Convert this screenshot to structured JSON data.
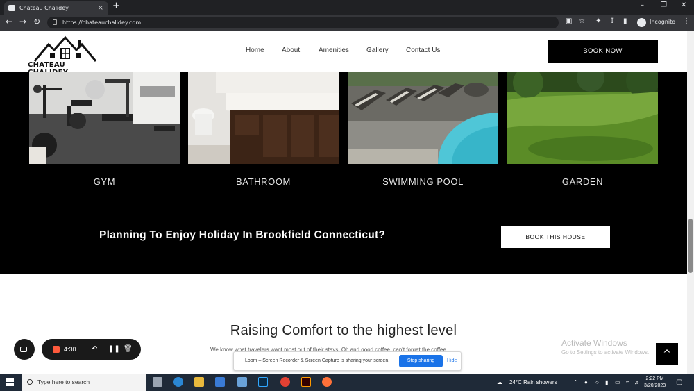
{
  "browser": {
    "tab_title": "Chateau Chalidey",
    "tab_close": "×",
    "new_tab": "+",
    "url": "https://chateauchalidey.com",
    "profile": "Incognito"
  },
  "site": {
    "logo_text": "CHATEAU CHALIDEY",
    "nav": [
      "Home",
      "About",
      "Amenities",
      "Gallery",
      "Contact Us"
    ],
    "book_now": "BOOK NOW",
    "amenities": [
      {
        "label": "GYM"
      },
      {
        "label": "BATHROOM"
      },
      {
        "label": "SWIMMING POOL"
      },
      {
        "label": "GARDEN"
      }
    ],
    "cta_text": "Planning To Enjoy Holiday In Brookfield Connecticut?",
    "cta_button": "BOOK THIS HOUSE",
    "section_title": "Raising Comfort to the highest level",
    "section_text": "We know what travelers want most out of their stays. Oh and good coffee, can't forget the coffee",
    "back_to_top": "^"
  },
  "windows_watermark": {
    "title": "Activate Windows",
    "subtitle": "Go to Settings to activate Windows."
  },
  "loom": {
    "timer": "4:30",
    "share_text": "Loom – Screen Recorder & Screen Capture is sharing your screen.",
    "stop_sharing": "Stop sharing",
    "hide": "Hide"
  },
  "taskbar": {
    "search_placeholder": "Type here to search",
    "weather": "24°C  Rain showers",
    "time": "2:22 PM",
    "date": "3/20/2023"
  },
  "colors": {
    "dark_section": "#000000",
    "accent_blue": "#1a73e8",
    "loom_record": "#ff5a3c"
  }
}
